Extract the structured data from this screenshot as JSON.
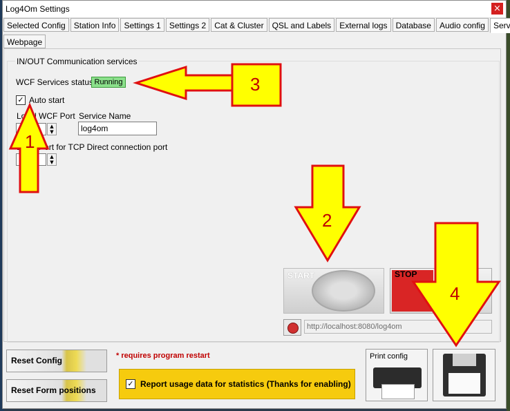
{
  "window": {
    "title": "Log4Om Settings",
    "close_glyph": "×"
  },
  "tabs_row1": [
    "Selected Config",
    "Station Info",
    "Settings 1",
    "Settings 2",
    "Cat & Cluster",
    "QSL and Labels",
    "External logs",
    "Database",
    "Audio config",
    "Services"
  ],
  "tabs_row2": [
    "Webpage"
  ],
  "active_tab": "Services",
  "services": {
    "group_title": "IN/OUT Communication services",
    "wcf_status_label": "WCF Services status",
    "wcf_status_value": "Running",
    "auto_start_label": "Auto start",
    "auto_start_checked": true,
    "wcf_port_label": "Local WCF Port",
    "wcf_port_value": "8",
    "service_name_label": "Service Name",
    "service_name_value": "log4om",
    "tcp_port_label": "Local Port for TCP Direct connection port",
    "tcp_port_value": "8",
    "start_label": "START",
    "stop_label": "STOP",
    "url_value": "http://localhost:8080/log4om"
  },
  "footer": {
    "reset_config_label": "Reset Config",
    "reset_forms_label": "Reset Form positions",
    "restart_note": "* requires program restart",
    "report_label": "Report usage data for statistics (Thanks for enabling)",
    "report_checked": true,
    "print_label": "Print config"
  },
  "annotations": {
    "n1": "1",
    "n2": "2",
    "n3": "3",
    "n4": "4"
  },
  "colors": {
    "arrow_fill": "#ffff00",
    "arrow_stroke": "#e01010",
    "running": "#8be08b",
    "report_bg": "#f6cb0e"
  },
  "icons": {
    "close": "close-icon",
    "start": "start-dial-icon",
    "stop": "stop-icon",
    "url": "web-globe-icon",
    "print": "printer-icon",
    "save": "floppy-disk-icon",
    "check": "check-icon"
  }
}
